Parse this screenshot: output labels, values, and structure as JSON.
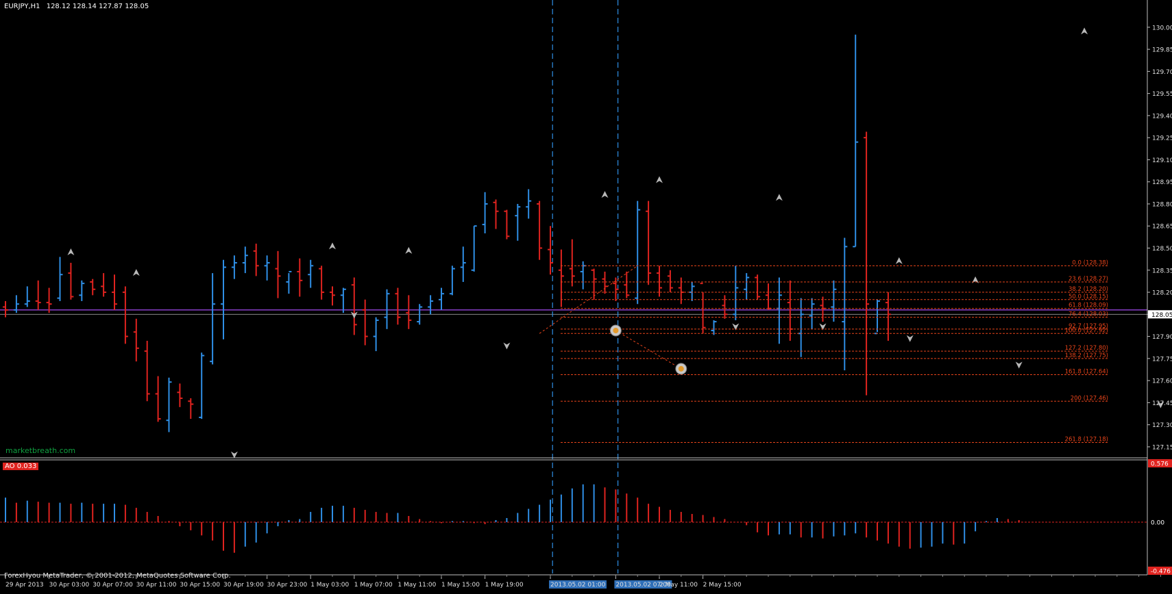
{
  "header": {
    "symbol": "EURJPY,H1",
    "ohlc": "128.12 128.14 127.87 128.05"
  },
  "watermark": "marketbreath.com",
  "copyright": "ForexHyou MetaTrader, © 2001-2012, MetaQuotes Software Corp.",
  "colors": {
    "up": "#2f8fe6",
    "down": "#e0231f",
    "background": "#000000",
    "axis": "#c0c0c0",
    "fib": "#e8441a",
    "current_line": "#8a3fc9",
    "watermark": "#10a040"
  },
  "chart_data": [
    {
      "type": "ohlc",
      "title": "EURJPY,H1",
      "ylim": [
        127.08,
        130.12
      ],
      "yticks": [
        "130.00",
        "129.85",
        "129.70",
        "129.55",
        "129.40",
        "129.25",
        "129.10",
        "128.95",
        "128.80",
        "128.65",
        "128.50",
        "128.35",
        "128.20",
        "128.05",
        "127.90",
        "127.75",
        "127.60",
        "127.45",
        "127.30",
        "127.15"
      ],
      "current_price": "128.05",
      "current_price_raw": 128.05,
      "horizontal_line_price": 128.08,
      "xticks": [
        "29 Apr 2013",
        "30 Apr 03:00",
        "30 Apr 07:00",
        "30 Apr 11:00",
        "30 Apr 15:00",
        "30 Apr 19:00",
        "30 Apr 23:00",
        "1 May 03:00",
        "1 May 07:00",
        "1 May 11:00",
        "1 May 15:00",
        "1 May 19:00",
        "2013.05.02 01:00",
        "2013.05.02 07:00",
        "2 May 11:00",
        "2 May 15:00"
      ],
      "xtick_bars": [
        0,
        4,
        8,
        12,
        16,
        20,
        24,
        28,
        32,
        36,
        40,
        44,
        50,
        56,
        60,
        64
      ],
      "highlight_ticks": [
        "2013.05.02 01:00",
        "2013.05.02 07:00"
      ],
      "vlines_at_bars": [
        50.2,
        56.2
      ],
      "bars": [
        [
          128.1,
          128.14,
          128.03,
          128.08
        ],
        [
          128.08,
          128.18,
          128.06,
          128.12
        ],
        [
          128.12,
          128.24,
          128.1,
          128.14
        ],
        [
          128.14,
          128.28,
          128.08,
          128.13
        ],
        [
          128.13,
          128.23,
          128.06,
          128.12
        ],
        [
          128.16,
          128.44,
          128.14,
          128.32
        ],
        [
          128.33,
          128.4,
          128.15,
          128.17
        ],
        [
          128.18,
          128.28,
          128.14,
          128.26
        ],
        [
          128.27,
          128.29,
          128.18,
          128.22
        ],
        [
          128.24,
          128.33,
          128.17,
          128.2
        ],
        [
          128.2,
          128.32,
          128.08,
          128.12
        ],
        [
          128.2,
          128.24,
          127.85,
          127.9
        ],
        [
          127.93,
          128.02,
          127.73,
          127.82
        ],
        [
          127.8,
          127.87,
          127.46,
          127.51
        ],
        [
          127.51,
          127.63,
          127.32,
          127.34
        ],
        [
          127.33,
          127.62,
          127.25,
          127.59
        ],
        [
          127.52,
          127.58,
          127.42,
          127.48
        ],
        [
          127.46,
          127.48,
          127.34,
          127.44
        ],
        [
          127.35,
          127.79,
          127.34,
          127.77
        ],
        [
          127.73,
          128.33,
          127.71,
          128.12
        ],
        [
          128.12,
          128.42,
          127.88,
          128.37
        ],
        [
          128.37,
          128.45,
          128.29,
          128.4
        ],
        [
          128.4,
          128.51,
          128.33,
          128.45
        ],
        [
          128.48,
          128.53,
          128.31,
          128.38
        ],
        [
          128.38,
          128.45,
          128.28,
          128.4
        ],
        [
          128.36,
          128.48,
          128.16,
          128.31
        ],
        [
          128.27,
          128.33,
          128.19,
          128.34
        ],
        [
          128.34,
          128.43,
          128.17,
          128.28
        ],
        [
          128.32,
          128.42,
          128.23,
          128.38
        ],
        [
          128.36,
          128.38,
          128.15,
          128.2
        ],
        [
          128.2,
          128.24,
          128.11,
          128.18
        ],
        [
          128.18,
          128.23,
          128.06,
          128.22
        ],
        [
          128.25,
          128.3,
          127.91,
          127.98
        ],
        [
          128.08,
          128.15,
          127.84,
          127.9
        ],
        [
          127.9,
          128.03,
          127.8,
          128.01
        ],
        [
          128.03,
          128.22,
          127.95,
          128.19
        ],
        [
          128.19,
          128.23,
          127.98,
          128.03
        ],
        [
          128.06,
          128.18,
          127.95,
          128.01
        ],
        [
          128.0,
          128.12,
          127.98,
          128.1
        ],
        [
          128.1,
          128.18,
          128.05,
          128.14
        ],
        [
          128.15,
          128.23,
          128.08,
          128.19
        ],
        [
          128.19,
          128.38,
          128.18,
          128.36
        ],
        [
          128.37,
          128.51,
          128.27,
          128.4
        ],
        [
          128.35,
          128.65,
          128.34,
          128.65
        ],
        [
          128.66,
          128.88,
          128.6,
          128.8
        ],
        [
          128.81,
          128.83,
          128.63,
          128.75
        ],
        [
          128.75,
          128.76,
          128.56,
          128.58
        ],
        [
          128.72,
          128.8,
          128.55,
          128.78
        ],
        [
          128.78,
          128.9,
          128.7,
          128.82
        ],
        [
          128.8,
          128.82,
          128.42,
          128.5
        ],
        [
          128.49,
          128.65,
          128.32,
          128.4
        ],
        [
          128.35,
          128.49,
          128.1,
          128.31
        ],
        [
          128.36,
          128.56,
          128.24,
          128.31
        ],
        [
          128.34,
          128.41,
          128.22,
          128.38
        ],
        [
          128.35,
          128.36,
          128.15,
          128.29
        ],
        [
          128.29,
          128.34,
          128.19,
          128.24
        ],
        [
          128.26,
          128.3,
          128.14,
          128.22
        ],
        [
          128.25,
          128.34,
          128.16,
          128.18
        ],
        [
          128.16,
          128.82,
          128.12,
          128.76
        ],
        [
          128.75,
          128.82,
          128.25,
          128.33
        ],
        [
          128.33,
          128.38,
          128.17,
          128.23
        ],
        [
          128.31,
          128.35,
          128.2,
          128.23
        ],
        [
          128.23,
          128.3,
          128.12,
          128.2
        ],
        [
          128.2,
          128.27,
          128.14,
          128.24
        ],
        [
          128.26,
          128.2,
          127.92,
          127.96
        ],
        [
          127.94,
          128.01,
          127.91,
          128.0
        ],
        [
          128.11,
          128.18,
          128.02,
          128.05
        ],
        [
          128.05,
          128.38,
          128.01,
          128.23
        ],
        [
          128.22,
          128.33,
          128.15,
          128.3
        ],
        [
          128.3,
          128.32,
          128.15,
          128.17
        ],
        [
          128.18,
          128.26,
          128.08,
          128.09
        ],
        [
          128.09,
          128.3,
          127.85,
          128.18
        ],
        [
          128.13,
          128.28,
          127.87,
          127.95
        ],
        [
          127.92,
          128.16,
          127.76,
          128.05
        ],
        [
          128.04,
          128.16,
          127.95,
          128.12
        ],
        [
          128.11,
          128.17,
          128.0,
          128.09
        ],
        [
          128.1,
          128.28,
          128.0,
          128.22
        ],
        [
          128.0,
          128.57,
          127.67,
          128.51
        ],
        [
          128.51,
          129.95,
          128.51,
          129.22
        ],
        [
          129.25,
          129.29,
          127.5,
          128.12
        ],
        [
          127.92,
          128.15,
          127.93,
          128.14
        ],
        [
          128.13,
          128.2,
          127.87,
          128.05
        ]
      ],
      "fractals_up": [
        [
          6,
          128.47
        ],
        [
          12,
          128.33
        ],
        [
          30,
          128.51
        ],
        [
          37,
          128.48
        ],
        [
          55,
          128.86
        ],
        [
          60,
          128.96
        ],
        [
          71,
          128.84
        ],
        [
          82,
          128.41
        ],
        [
          89,
          128.28
        ],
        [
          99,
          129.97
        ]
      ],
      "fractals_down": [
        [
          32,
          128.05
        ],
        [
          46,
          127.84
        ],
        [
          67,
          127.97
        ],
        [
          75,
          127.97
        ],
        [
          83,
          127.89
        ],
        [
          93,
          127.71
        ],
        [
          106,
          127.44
        ],
        [
          21,
          127.1
        ]
      ]
    },
    {
      "type": "bar",
      "title": "AO 0.033",
      "ylim": [
        -0.476,
        0.576
      ],
      "yticks": [
        "0.576",
        "0.00",
        "-0.476"
      ],
      "values": [
        0.24,
        0.19,
        0.21,
        0.2,
        0.19,
        0.19,
        0.18,
        0.19,
        0.18,
        0.18,
        0.18,
        0.17,
        0.14,
        0.1,
        0.06,
        0.01,
        -0.04,
        -0.08,
        -0.13,
        -0.18,
        -0.28,
        -0.3,
        -0.24,
        -0.2,
        -0.11,
        -0.04,
        0.02,
        0.03,
        0.1,
        0.14,
        0.16,
        0.16,
        0.14,
        0.12,
        0.1,
        0.09,
        0.09,
        0.06,
        0.03,
        0.01,
        -0.01,
        0.01,
        0.01,
        -0.01,
        -0.02,
        0.02,
        0.04,
        0.09,
        0.13,
        0.17,
        0.22,
        0.27,
        0.33,
        0.37,
        0.37,
        0.34,
        0.32,
        0.28,
        0.24,
        0.18,
        0.15,
        0.12,
        0.1,
        0.08,
        0.07,
        0.05,
        0.03,
        0.0,
        -0.03,
        -0.1,
        -0.13,
        -0.12,
        -0.12,
        -0.15,
        -0.15,
        -0.16,
        -0.14,
        -0.13,
        -0.11,
        -0.15,
        -0.18,
        -0.21,
        -0.24,
        -0.26,
        -0.25,
        -0.24,
        -0.21,
        -0.22,
        -0.21,
        -0.09,
        0.01,
        0.04,
        0.03,
        0.02
      ],
      "colors_up_down": true
    }
  ],
  "fibonacci": {
    "levels": [
      {
        "label": "0.0 (128.38)",
        "price": 128.38
      },
      {
        "label": "23.6 (128.27)",
        "price": 128.27
      },
      {
        "label": "38.2 (128.20)",
        "price": 128.2
      },
      {
        "label": "50.0 (128.15)",
        "price": 128.15
      },
      {
        "label": "61.8 (128.09)",
        "price": 128.09
      },
      {
        "label": "76.4 (128.03)",
        "price": 128.03
      },
      {
        "label": "92.7 (127.95)",
        "price": 127.95
      },
      {
        "label": "100.0 (127.92)",
        "price": 127.92
      },
      {
        "label": "127.2 (127.80)",
        "price": 127.8
      },
      {
        "label": "138.2 (127.75)",
        "price": 127.75
      },
      {
        "label": "161.8 (127.64)",
        "price": 127.64
      },
      {
        "label": "200 (127.46)",
        "price": 127.46
      },
      {
        "label": "261.8 (127.18)",
        "price": 127.18
      }
    ]
  }
}
